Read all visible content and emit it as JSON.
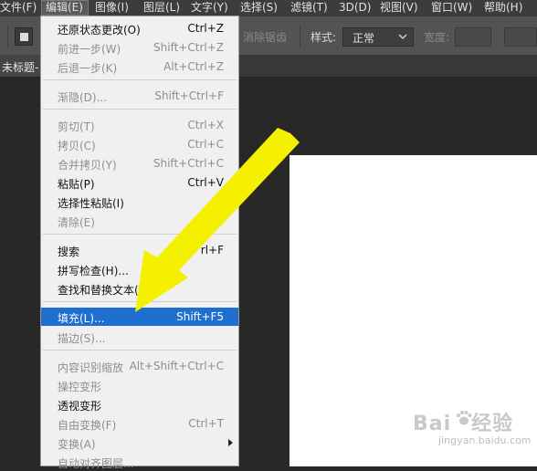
{
  "menubar": {
    "items": [
      {
        "label": "文件(F)"
      },
      {
        "label": "编辑(E)"
      },
      {
        "label": "图像(I)"
      },
      {
        "label": "图层(L)"
      },
      {
        "label": "文字(Y)"
      },
      {
        "label": "选择(S)"
      },
      {
        "label": "滤镜(T)"
      },
      {
        "label": "3D(D)"
      },
      {
        "label": "视图(V)"
      },
      {
        "label": "窗口(W)"
      },
      {
        "label": "帮助(H)"
      }
    ]
  },
  "options_bar": {
    "antialias_label": "消除锯齿",
    "style_label": "样式:",
    "style_value": "正常",
    "width_label": "宽度:"
  },
  "doc_tab": {
    "title": "未标题-"
  },
  "edit_menu": {
    "items": [
      {
        "label": "还原状态更改(O)",
        "shortcut": "Ctrl+Z"
      },
      {
        "label": "前进一步(W)",
        "shortcut": "Shift+Ctrl+Z"
      },
      {
        "label": "后退一步(K)",
        "shortcut": "Alt+Ctrl+Z"
      },
      {
        "label": "渐隐(D)...",
        "shortcut": "Shift+Ctrl+F"
      },
      {
        "label": "剪切(T)",
        "shortcut": "Ctrl+X"
      },
      {
        "label": "拷贝(C)",
        "shortcut": "Ctrl+C"
      },
      {
        "label": "合并拷贝(Y)",
        "shortcut": "Shift+Ctrl+C"
      },
      {
        "label": "粘贴(P)",
        "shortcut": "Ctrl+V"
      },
      {
        "label": "选择性粘贴(I)",
        "shortcut": ""
      },
      {
        "label": "清除(E)",
        "shortcut": ""
      },
      {
        "label": "搜索",
        "shortcut": "rl+F"
      },
      {
        "label": "拼写检查(H)...",
        "shortcut": ""
      },
      {
        "label": "查找和替换文本(X",
        "shortcut": ""
      },
      {
        "label": "填充(L)...",
        "shortcut": "Shift+F5"
      },
      {
        "label": "描边(S)...",
        "shortcut": ""
      },
      {
        "label": "内容识别缩放",
        "shortcut": "Alt+Shift+Ctrl+C"
      },
      {
        "label": "操控变形",
        "shortcut": ""
      },
      {
        "label": "透视变形",
        "shortcut": ""
      },
      {
        "label": "自由变换(F)",
        "shortcut": "Ctrl+T"
      },
      {
        "label": "变换(A)",
        "shortcut": ""
      },
      {
        "label": "自动对齐图层...",
        "shortcut": ""
      }
    ]
  },
  "watermark": {
    "brand": "Bai",
    "brand2": "经验",
    "url": "jingyan.baidu.com"
  },
  "colors": {
    "highlight": "#1f6fd1",
    "arrow": "#f5f000",
    "menu_bg": "#f0f0f0",
    "app_bg": "#282828"
  }
}
